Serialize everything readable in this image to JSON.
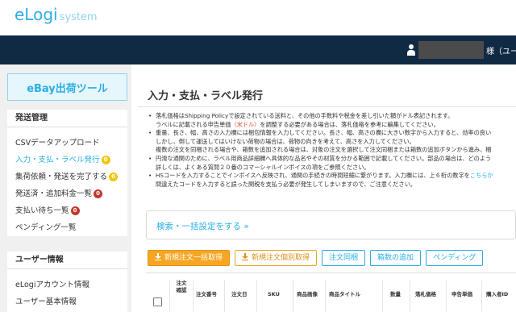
{
  "app": {
    "logo_main": "eLogi",
    "logo_sub": "system",
    "user_suffix": "様（ユー"
  },
  "sidebar": {
    "title": "eBay出荷ツール",
    "sections": [
      {
        "heading": "発送管理",
        "items": [
          {
            "label": "CSVデータアップロード",
            "badge": null,
            "active": false
          },
          {
            "label": "入力・支払・ラベル発行",
            "badge": "0",
            "badge_color": "#f1c40f",
            "active": true
          },
          {
            "label": "集荷依頼・発送を完了する",
            "badge": "0",
            "badge_color": "#f1c40f",
            "active": false
          },
          {
            "label": "発送済・追加料金一覧",
            "badge": "0",
            "badge_color": "#c0392b",
            "active": false
          },
          {
            "label": "支払い待ち一覧",
            "badge": "0",
            "badge_color": "#c0392b",
            "active": false
          },
          {
            "label": "ペンディング一覧",
            "badge": null,
            "active": false
          }
        ]
      },
      {
        "heading": "ユーザー情報",
        "items": [
          {
            "label": "eLogiアカウント情報"
          },
          {
            "label": "ユーザー基本情報"
          }
        ]
      }
    ]
  },
  "main": {
    "title": "入力・支払・ラベル発行",
    "notes": [
      "落札価格はShipping Policyで設定されている送料と、その他の手数料や税金を差し引いた額がドル表記されます。",
      "ラベルに記載される申告単価（米ドル）を調整する必要がある場合は、落札価格を参考に編集してください。",
      "重量、長さ、幅、高さの入力欄には梱包情報を入力してください。長さ、幅、高さの欄に大きい数字から入力すると、効率の良い",
      "しかし、倒して運送してはいけない荷物の場合は、荷物の向きを考えて、高さを入力してください。",
      "複数の注文を同梱される場合や、箱数を追加される場合は、対象の注文を選択して注文同梱または箱数の追加ボタンから進み、梱",
      "円滑な通関のために、ラベル用商品詳細欄へ具体的な品名やその材質を分かる範囲で記載してください。部品の場合は、どのよう",
      "詳しくは、よくある質問２０番のコマーシャルインボイスの項をご参照ください。",
      "HSコードを入力することでインボイスへ反映され、通関の手続きの時間短縮に繋がります。入力欄には、上６桁の数字をこちらか",
      "間違えたコードを入力すると誤った関税を支払う必要が発生してしまいますので、ご注意ください。"
    ],
    "note_red": "（米ドル）",
    "note_link": "こちらか",
    "search_link": "検索・一括設定をする »",
    "buttons": {
      "bulk": "新規注文一括取得",
      "single": "新規注文個別取得",
      "combine": "注文同梱",
      "add_box": "箱数の追加",
      "pending": "ペンディング"
    },
    "table_headers": [
      "注文\n確認",
      "注文番号",
      "注文日",
      "SKU",
      "商品画像",
      "商品タイトル",
      "数量",
      "落札価格",
      "申告単価",
      "購入者ID"
    ]
  },
  "colors": {
    "accent": "#2aaee6",
    "navbar": "#102a43",
    "primary_button": "#f5a623",
    "badge_yellow": "#f1c40f",
    "badge_red": "#c0392b"
  }
}
